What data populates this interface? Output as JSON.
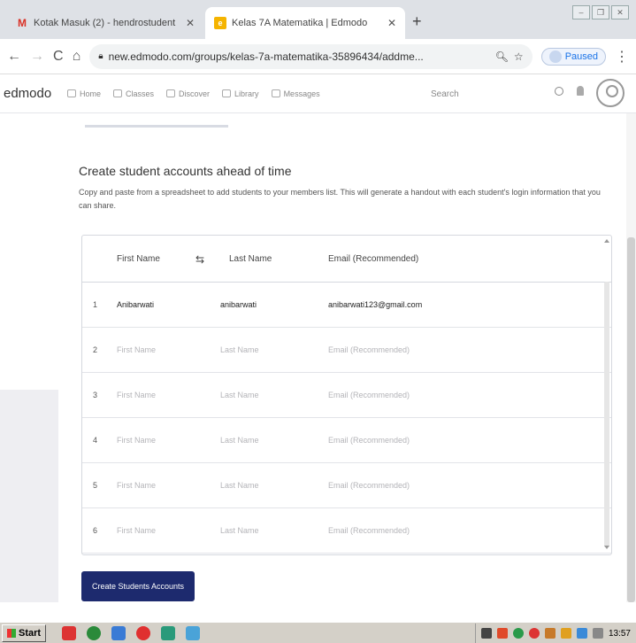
{
  "browser": {
    "tabs": [
      {
        "title": "Kotak Masuk (2) - hendrostudent",
        "icon": "gmail-icon"
      },
      {
        "title": "Kelas 7A Matematika | Edmodo",
        "icon": "edmodo-icon"
      }
    ],
    "url": "new.edmodo.com/groups/kelas-7a-matematika-35896434/addme...",
    "profile_label": "Paused"
  },
  "edmodo": {
    "logo": "edmodo",
    "nav": [
      "Home",
      "Classes",
      "Discover",
      "Library",
      "Messages"
    ],
    "search_placeholder": "Search"
  },
  "page": {
    "heading": "Create student accounts ahead of time",
    "description": "Copy and paste from a spreadsheet to add students to your members list. This will generate a handout with each student's login information that you can share.",
    "columns": {
      "first": "First Name",
      "last": "Last Name",
      "email": "Email (Recommended)"
    },
    "placeholders": {
      "first": "First Name",
      "last": "Last Name",
      "email": "Email (Recommended)"
    },
    "rows": [
      {
        "n": "1",
        "first": "Anibarwati",
        "last": "anibarwati",
        "email": "anibarwati123@gmail.com"
      },
      {
        "n": "2"
      },
      {
        "n": "3"
      },
      {
        "n": "4"
      },
      {
        "n": "5"
      },
      {
        "n": "6"
      }
    ],
    "button": "Create Students Accounts"
  },
  "taskbar": {
    "start": "Start",
    "clock": "13:57"
  }
}
